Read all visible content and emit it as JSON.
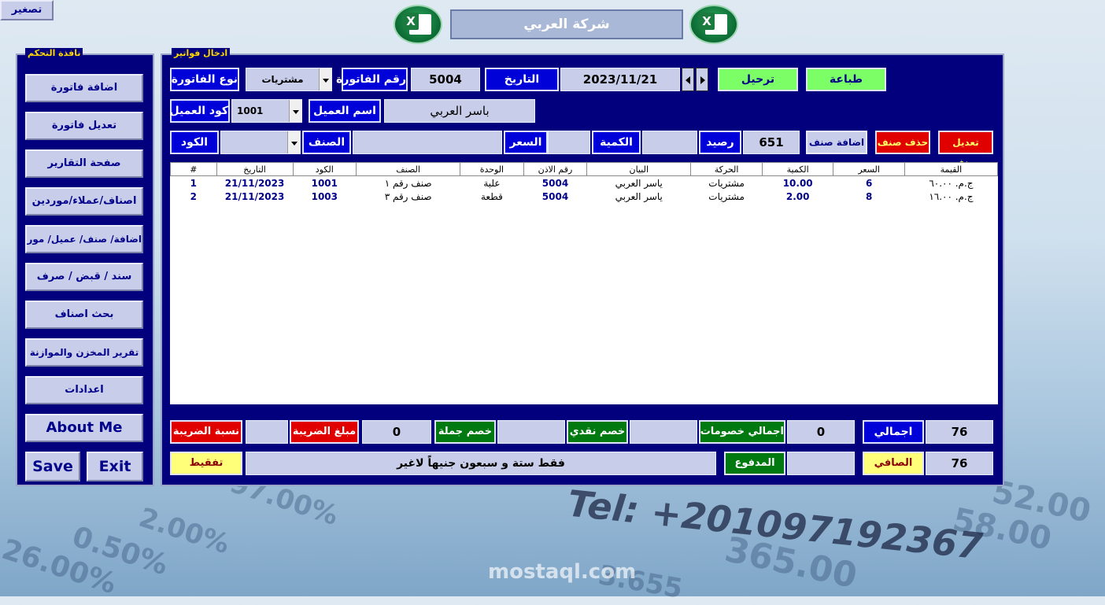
{
  "window": {
    "minimize_label": "تصغير",
    "company_name": "شركة العربي"
  },
  "control_panel": {
    "title": "نافذة التحكم",
    "buttons": [
      "اضافة فاتورة",
      "تعديل فاتورة",
      "صفحة التقارير",
      "اصناف/عملاء/موردين",
      "اضافة/ صنف/ عميل/ مورد",
      "سند / قبض / صرف",
      "بحث اصناف",
      "تقرير المخزن والموازنة",
      "اعدادات",
      "About Me"
    ],
    "save_label": "Save",
    "exit_label": "Exit"
  },
  "invoice": {
    "title": "ادخال فواتير",
    "type_label": "نوع الفاتورة",
    "type_value": "مشتريات",
    "number_label": "رقم الفاتورة",
    "number_value": "5004",
    "date_label": "التاريخ",
    "date_value": "2023/11/21",
    "post_label": "ترحيل",
    "print_label": "طباعة",
    "customer_code_label": "كود العميل",
    "customer_code_value": "1001",
    "customer_name_label": "اسم العميل",
    "customer_name_value": "باسر العربي",
    "code_label": "الكود",
    "code_value": "",
    "item_label": "الصنف",
    "item_value": "",
    "price_label": "السعر",
    "price_value": "",
    "qty_label": "الكمية",
    "qty_value": "",
    "balance_label": "رصيد",
    "balance_value": "651",
    "add_item_label": "اضافة صنف",
    "delete_item_label": "حذف صنف",
    "edit_item_label": "تعديل صنف"
  },
  "table": {
    "columns": [
      "#",
      "التاريخ",
      "الكود",
      "الصنف",
      "الوحدة",
      "رقم الاذن",
      "البيان",
      "الحركة",
      "الكمية",
      "السعر",
      "القيمة"
    ],
    "rows": [
      [
        "1",
        "21/11/2023",
        "1001",
        "صنف رقم ١",
        "علبة",
        "5004",
        "ياسر العربي",
        "مشتريات",
        "10.00",
        "6",
        "ج.م. ٦٠.٠٠"
      ],
      [
        "2",
        "21/11/2023",
        "1003",
        "صنف رقم ٣",
        "قطعة",
        "5004",
        "ياسر العربي",
        "مشتريات",
        "2.00",
        "8",
        "ج.م. ١٦.٠٠"
      ]
    ]
  },
  "totals": {
    "tax_rate_label": "نسبة الضريبة",
    "tax_rate_value": "",
    "tax_amount_label": "مبلغ الضريبة",
    "tax_amount_value": "0",
    "wholesale_discount_label": "خصم جملة",
    "wholesale_discount_value": "",
    "cash_discount_label": "خصم نقدي",
    "cash_discount_value": "",
    "total_discounts_label": "اجمالي خصومات",
    "total_discounts_value": "0",
    "total_label": "اجمالي",
    "total_value": "76",
    "tafqeet_label": "تفقيط",
    "tafqeet_value": "فقط ستة و سبعون جنيهاً لاغير",
    "paid_label": "المدفوع",
    "paid_value": "",
    "net_label": "الصافي",
    "net_value": "76"
  },
  "background": {
    "tel": "Tel: +201097192367",
    "watermark": "mostaql.com",
    "numbers": [
      "97.00%",
      "2.00%",
      "0.50%",
      "26.00%",
      "365.00",
      "58.00",
      "52.00",
      "3.655"
    ]
  },
  "colors": {
    "panel": "#02007c",
    "label_blue": "#0000d8",
    "button_green": "#7cff66",
    "button_red": "#e00000",
    "label_yellow": "#ffff7a"
  }
}
